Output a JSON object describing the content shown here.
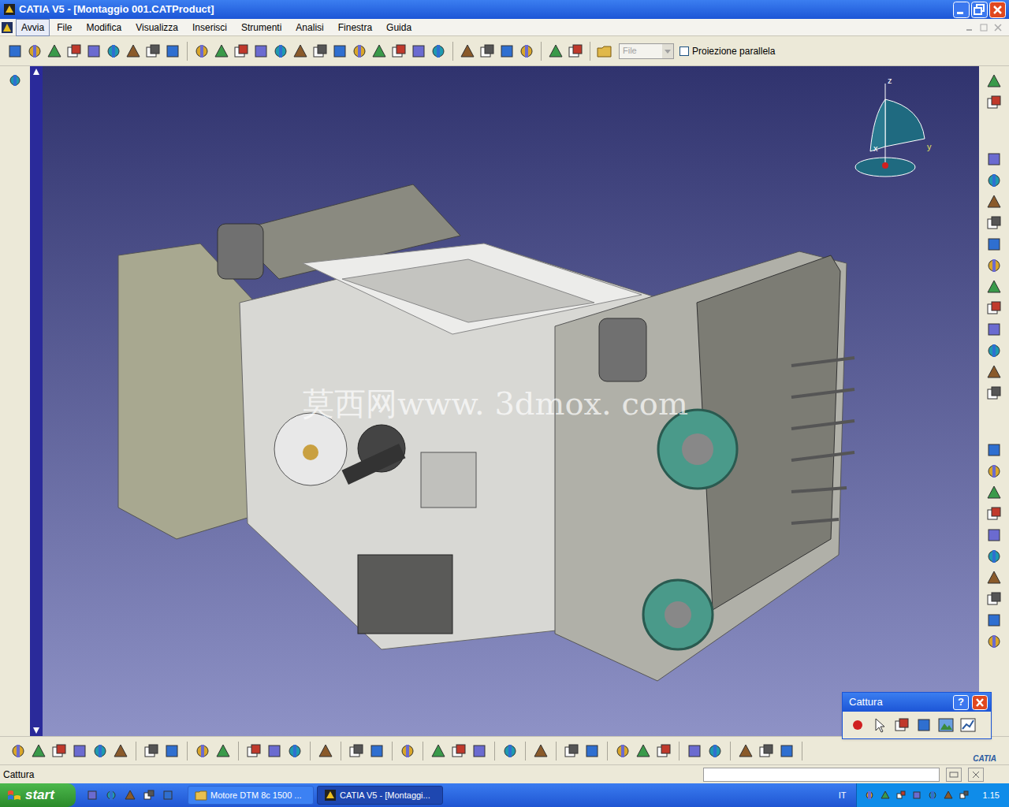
{
  "window": {
    "title": "CATIA V5 - [Montaggio 001.CATProduct]"
  },
  "menu": [
    {
      "label": "Avvia",
      "selected": true
    },
    {
      "label": "File",
      "selected": false
    },
    {
      "label": "Modifica",
      "selected": false
    },
    {
      "label": "Visualizza",
      "selected": false
    },
    {
      "label": "Inserisci",
      "selected": false
    },
    {
      "label": "Strumenti",
      "selected": false
    },
    {
      "label": "Analisi",
      "selected": false
    },
    {
      "label": "Finestra",
      "selected": false
    },
    {
      "label": "Guida",
      "selected": false
    }
  ],
  "toolbar": {
    "file_combo": {
      "value": "File",
      "disabled": true
    },
    "parallel_projection": {
      "label": "Proiezione parallela",
      "checked": false
    }
  },
  "viewport": {
    "watermark": "莫西网www. 3dmox. com",
    "compass": {
      "z": "z",
      "x": "x",
      "y": "y"
    }
  },
  "capture_toolbar": {
    "title": "Cattura",
    "help": "?"
  },
  "brand": "CATIA",
  "status_bar": {
    "text": "Cattura"
  },
  "taskbar": {
    "start": "start",
    "tasks": [
      {
        "label": "Motore DTM 8c 1500 ...",
        "selected": false
      },
      {
        "label": "CATIA V5 - [Montaggi...",
        "selected": true
      }
    ],
    "language": "IT",
    "clock": "1.15"
  }
}
